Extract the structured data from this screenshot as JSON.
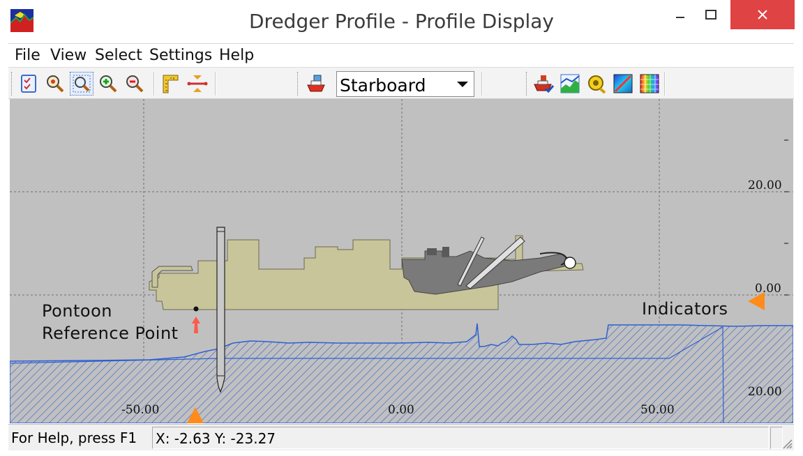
{
  "window": {
    "title": "Dredger Profile - Profile Display",
    "close_color": "#e04343"
  },
  "menu": {
    "items": [
      "File",
      "View",
      "Select",
      "Settings",
      "Help"
    ]
  },
  "toolbar": {
    "icons": [
      "properties-icon",
      "zoom-icon",
      "zoom-window-icon",
      "zoom-in-icon",
      "zoom-out-icon",
      "ruler-icon",
      "distance-icon",
      "vessel-view-icon",
      "vessel-settings-icon",
      "profile-chart-icon",
      "tape-measure-icon",
      "color-gradient-icon",
      "color-palette-icon"
    ],
    "view_select": {
      "value": "Starboard"
    }
  },
  "plot": {
    "colors": {
      "background": "#c0c0c0",
      "hull": "#c8c59a",
      "machinery": "#7a7a7a",
      "seabed": "#2f5fd0",
      "grid": "#6e6e6e",
      "indicator": "#ff8c1a",
      "reference_arrow": "#ff5a4a"
    },
    "x_ticks": [
      "-50.00",
      "0.00",
      "50.00"
    ],
    "y_ticks": [
      "20.00",
      "0.00",
      "20.00"
    ],
    "annotations": {
      "pontoon_line1": "Pontoon",
      "pontoon_line2": "Reference Point",
      "indicators": "Indicators"
    }
  },
  "status": {
    "help": "For Help, press F1",
    "coords": "X: -2.63 Y: -23.27"
  }
}
